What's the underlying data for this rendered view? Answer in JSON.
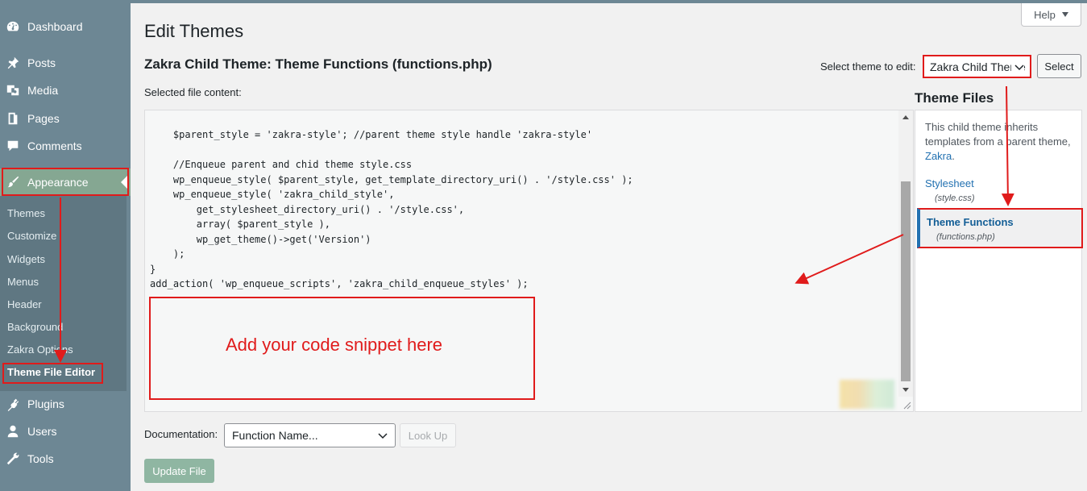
{
  "sidebar": {
    "items": [
      {
        "label": "Dashboard",
        "icon": "dashboard-icon"
      },
      {
        "label": "Posts",
        "icon": "pin-icon"
      },
      {
        "label": "Media",
        "icon": "media-icon"
      },
      {
        "label": "Pages",
        "icon": "pages-icon"
      },
      {
        "label": "Comments",
        "icon": "comments-icon"
      },
      {
        "label": "Appearance",
        "icon": "appearance-brush-icon"
      },
      {
        "label": "Plugins",
        "icon": "plugins-icon"
      },
      {
        "label": "Users",
        "icon": "users-icon"
      },
      {
        "label": "Tools",
        "icon": "tools-wrench-icon"
      }
    ],
    "submenu": [
      "Themes",
      "Customize",
      "Widgets",
      "Menus",
      "Header",
      "Background",
      "Zakra Options",
      "Theme File Editor"
    ]
  },
  "header": {
    "help_label": "Help",
    "page_title": "Edit Themes",
    "file_title": "Zakra Child Theme: Theme Functions (functions.php)",
    "selected_file_label": "Selected file content:",
    "select_theme_label": "Select theme to edit:",
    "theme_select_value": "Zakra Child Theme",
    "select_button": "Select"
  },
  "code_lines": [
    "    $parent_style = 'zakra-style'; //parent theme style handle 'zakra-style'",
    "",
    "    //Enqueue parent and chid theme style.css",
    "    wp_enqueue_style( $parent_style, get_template_directory_uri() . '/style.css' );",
    "    wp_enqueue_style( 'zakra_child_style',",
    "        get_stylesheet_directory_uri() . '/style.css',",
    "        array( $parent_style ),",
    "        wp_get_theme()->get('Version')",
    "    );",
    "}",
    "add_action( 'wp_enqueue_scripts', 'zakra_child_enqueue_styles' );"
  ],
  "annotation": {
    "snippet_text": "Add your code snippet here"
  },
  "theme_files": {
    "title": "Theme Files",
    "inherit_text": "This child theme inherits templates from a parent theme, ",
    "inherit_link": "Zakra",
    "inherit_suffix": ".",
    "files": [
      {
        "name": "Stylesheet",
        "file": "(style.css)"
      },
      {
        "name": "Theme Functions",
        "file": "(functions.php)"
      }
    ]
  },
  "footer": {
    "documentation_label": "Documentation:",
    "function_select_value": "Function Name...",
    "lookup_button": "Look Up",
    "update_button": "Update File"
  },
  "colors": {
    "sidebar": "#6d8794",
    "appearance_active": "#85a792",
    "annotation_red": "#e01b1b",
    "link_blue": "#2271b1"
  }
}
